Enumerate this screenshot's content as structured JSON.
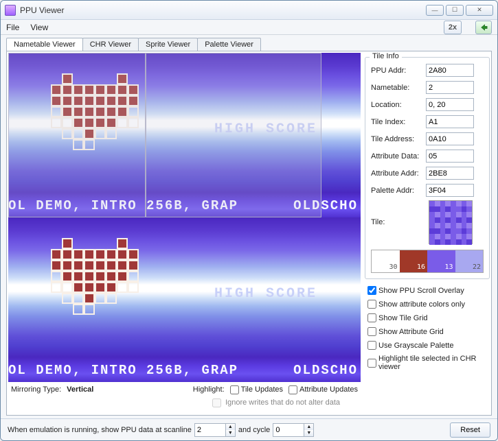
{
  "window": {
    "title": "PPU Viewer"
  },
  "menu": {
    "file": "File",
    "view": "View",
    "zoom": "2x"
  },
  "tabs": {
    "nametable": "Nametable Viewer",
    "chr": "CHR Viewer",
    "sprite": "Sprite Viewer",
    "palette": "Palette Viewer"
  },
  "viewer": {
    "highscore": "HIGH SCORE",
    "scroll_left": "OL DEMO, INTRO 256B, GRAP",
    "scroll_right": "OLDSCHO"
  },
  "status": {
    "mirroring_label": "Mirroring Type:",
    "mirroring_value": "Vertical",
    "highlight_label": "Highlight:",
    "tile_updates": "Tile Updates",
    "attr_updates": "Attribute Updates",
    "ignore": "Ignore writes that do not alter data"
  },
  "tileinfo": {
    "title": "Tile Info",
    "ppu_addr_label": "PPU Addr:",
    "ppu_addr": "2A80",
    "nametable_label": "Nametable:",
    "nametable": "2",
    "location_label": "Location:",
    "location": "0, 20",
    "tile_index_label": "Tile Index:",
    "tile_index": "A1",
    "tile_address_label": "Tile Address:",
    "tile_address": "0A10",
    "attr_data_label": "Attribute Data:",
    "attr_data": "05",
    "attr_addr_label": "Attribute Addr:",
    "attr_addr": "2BE8",
    "pal_addr_label": "Palette Addr:",
    "pal_addr": "3F04",
    "tile_label": "Tile:",
    "palette": [
      {
        "hex": "30",
        "color": "#ffffff",
        "fg": "#555"
      },
      {
        "hex": "16",
        "color": "#a03828",
        "fg": "#fff"
      },
      {
        "hex": "13",
        "color": "#7a5ce8",
        "fg": "#fff"
      },
      {
        "hex": "22",
        "color": "#a8a8f0",
        "fg": "#555"
      }
    ]
  },
  "options": {
    "scroll_overlay": "Show PPU Scroll Overlay",
    "attr_colors": "Show attribute colors only",
    "tile_grid": "Show Tile Grid",
    "attr_grid": "Show Attribute Grid",
    "grayscale": "Use Grayscale Palette",
    "highlight_chr": "Highlight tile selected in CHR viewer"
  },
  "bottom": {
    "pre": "When emulation is running, show PPU data at scanline",
    "scanline": "2",
    "mid": "and cycle",
    "cycle": "0",
    "reset": "Reset"
  }
}
